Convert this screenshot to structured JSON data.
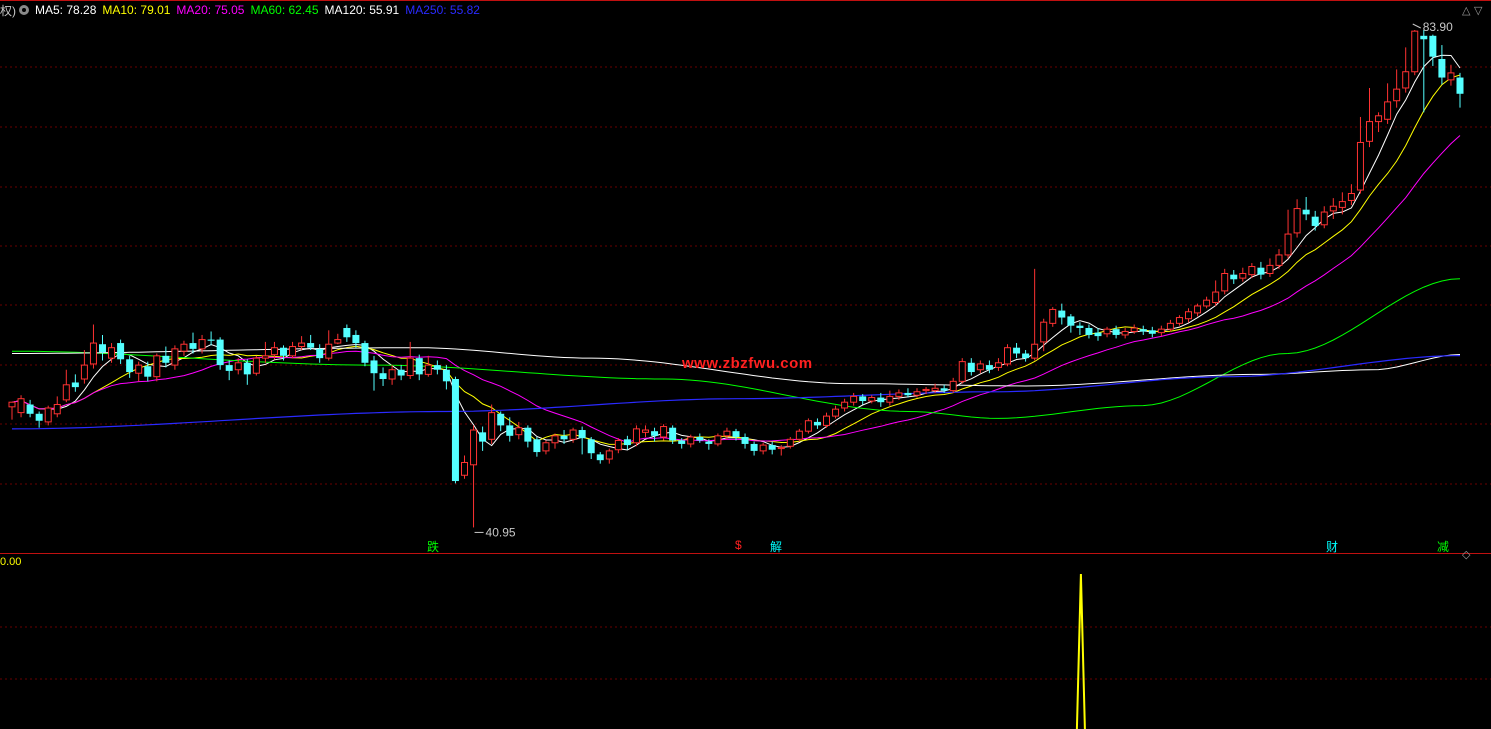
{
  "legend": {
    "prefix": "权)",
    "items": [
      {
        "label": "MA5: 78.28",
        "color": "#ffffff"
      },
      {
        "label": "MA10: 79.01",
        "color": "#ffff00"
      },
      {
        "label": "MA20: 75.05",
        "color": "#ff00ff"
      },
      {
        "label": "MA60: 62.45",
        "color": "#00ff00"
      },
      {
        "label": "MA120: 55.91",
        "color": "#ffffff"
      },
      {
        "label": "MA250: 55.82",
        "color": "#0000ff"
      }
    ]
  },
  "controls": {
    "up": "△",
    "down": "▽",
    "diamond": "◇"
  },
  "annotations": {
    "high": "83.90",
    "low": "40.95"
  },
  "watermark": "www.zbzfwu.com",
  "signals": [
    {
      "text": "跌",
      "color": "#00ff00"
    },
    {
      "text": "$",
      "color": "#ff2020"
    },
    {
      "text": "解",
      "color": "#00ffff"
    },
    {
      "text": "财",
      "color": "#00ffff"
    },
    {
      "text": "减",
      "color": "#00ff00"
    }
  ],
  "sub_panel": {
    "label": "0.00",
    "spike_index": 118
  },
  "chart_data": {
    "type": "candlestick",
    "price_range": [
      40.95,
      83.9
    ],
    "bars": [
      [
        51.4,
        51.8,
        51.6,
        50.3
      ],
      [
        50.9,
        52.1,
        52.4,
        50.5
      ],
      [
        51.6,
        50.8,
        52.0,
        50.5
      ],
      [
        50.8,
        50.2,
        51.0,
        49.6
      ],
      [
        50.1,
        51.3,
        51.5,
        49.8
      ],
      [
        50.8,
        51.6,
        52.3,
        50.5
      ],
      [
        52.0,
        53.3,
        54.6,
        51.8
      ],
      [
        53.5,
        53.1,
        54.2,
        52.7
      ],
      [
        53.8,
        55.0,
        56.3,
        53.4
      ],
      [
        55.1,
        56.9,
        58.5,
        54.7
      ],
      [
        56.8,
        56.1,
        57.6,
        55.4
      ],
      [
        55.6,
        56.5,
        56.9,
        55.2
      ],
      [
        56.9,
        55.5,
        57.2,
        55.1
      ],
      [
        55.5,
        54.4,
        55.8,
        53.9
      ],
      [
        54.3,
        55.0,
        55.3,
        53.6
      ],
      [
        54.9,
        54.0,
        55.3,
        53.6
      ],
      [
        54.0,
        55.8,
        56.0,
        53.6
      ],
      [
        55.8,
        55.2,
        56.6,
        54.8
      ],
      [
        55.0,
        56.4,
        56.7,
        54.6
      ],
      [
        56.2,
        56.8,
        57.1,
        55.8
      ],
      [
        56.9,
        56.4,
        57.8,
        56.0
      ],
      [
        56.4,
        57.2,
        57.6,
        56.0
      ],
      [
        57.2,
        57.1,
        57.9,
        56.7
      ],
      [
        57.2,
        55.0,
        57.4,
        54.6
      ],
      [
        55.0,
        54.5,
        55.4,
        53.7
      ],
      [
        54.6,
        55.2,
        55.6,
        54.2
      ],
      [
        55.2,
        54.2,
        55.5,
        53.3
      ],
      [
        54.3,
        55.6,
        55.8,
        54.1
      ],
      [
        55.6,
        55.8,
        57.0,
        55.2
      ],
      [
        55.9,
        56.5,
        57.0,
        55.5
      ],
      [
        56.5,
        55.8,
        56.7,
        55.4
      ],
      [
        55.8,
        56.6,
        57.0,
        55.6
      ],
      [
        56.6,
        56.9,
        57.5,
        56.3
      ],
      [
        56.9,
        56.5,
        57.6,
        56.3
      ],
      [
        56.4,
        55.6,
        56.8,
        55.2
      ],
      [
        55.6,
        56.8,
        58.0,
        55.4
      ],
      [
        56.9,
        57.2,
        57.7,
        56.8
      ],
      [
        58.2,
        57.4,
        58.5,
        57.0
      ],
      [
        57.6,
        56.9,
        58.0,
        56.5
      ],
      [
        56.9,
        55.2,
        57.1,
        54.9
      ],
      [
        55.4,
        54.3,
        55.8,
        52.8
      ],
      [
        54.3,
        53.8,
        54.8,
        53.2
      ],
      [
        53.8,
        54.6,
        55.0,
        53.3
      ],
      [
        54.6,
        54.1,
        55.0,
        53.7
      ],
      [
        54.1,
        55.6,
        57.0,
        53.8
      ],
      [
        55.6,
        54.2,
        55.9,
        53.7
      ],
      [
        54.2,
        55.0,
        55.8,
        54.0
      ],
      [
        55.0,
        54.6,
        55.4,
        54.2
      ],
      [
        54.6,
        53.6,
        55.0,
        52.9
      ],
      [
        53.8,
        45.0,
        54.0,
        44.8
      ],
      [
        45.5,
        46.6,
        47.2,
        45.2
      ],
      [
        46.4,
        49.4,
        49.8,
        41.0
      ],
      [
        49.2,
        48.4,
        49.7,
        47.6
      ],
      [
        48.6,
        50.9,
        51.6,
        48.2
      ],
      [
        50.8,
        49.8,
        51.0,
        49.3
      ],
      [
        49.8,
        48.9,
        50.5,
        48.4
      ],
      [
        49.0,
        49.6,
        50.1,
        48.6
      ],
      [
        49.6,
        48.4,
        49.8,
        47.9
      ],
      [
        48.6,
        47.5,
        48.8,
        47.1
      ],
      [
        47.6,
        48.3,
        48.5,
        47.3
      ],
      [
        48.3,
        48.9,
        49.1,
        47.8
      ],
      [
        48.9,
        48.6,
        49.4,
        48.2
      ],
      [
        48.6,
        49.4,
        49.6,
        48.3
      ],
      [
        49.4,
        48.7,
        49.7,
        47.3
      ],
      [
        48.6,
        47.4,
        48.8,
        46.9
      ],
      [
        47.3,
        46.8,
        47.5,
        46.5
      ],
      [
        46.9,
        47.6,
        47.8,
        46.5
      ],
      [
        47.7,
        48.5,
        48.7,
        47.4
      ],
      [
        48.6,
        48.1,
        48.9,
        47.7
      ],
      [
        48.3,
        49.5,
        49.8,
        48.0
      ],
      [
        49.2,
        49.4,
        49.8,
        48.8
      ],
      [
        49.3,
        48.9,
        49.6,
        48.4
      ],
      [
        48.8,
        49.7,
        49.9,
        48.5
      ],
      [
        49.6,
        48.5,
        49.8,
        48.2
      ],
      [
        48.5,
        48.2,
        48.7,
        47.8
      ],
      [
        48.2,
        48.8,
        49.0,
        47.9
      ],
      [
        48.8,
        48.5,
        49.1,
        48.3
      ],
      [
        48.4,
        48.2,
        48.6,
        47.7
      ],
      [
        48.2,
        48.9,
        49.1,
        48.0
      ],
      [
        48.9,
        49.3,
        49.6,
        48.6
      ],
      [
        49.3,
        48.8,
        49.5,
        48.5
      ],
      [
        48.8,
        48.2,
        49.1,
        47.8
      ],
      [
        48.2,
        47.6,
        48.4,
        47.2
      ],
      [
        47.6,
        48.1,
        48.3,
        47.3
      ],
      [
        48.1,
        47.7,
        48.4,
        47.3
      ],
      [
        47.8,
        47.9,
        48.1,
        47.2
      ],
      [
        48.0,
        48.6,
        48.8,
        47.8
      ],
      [
        48.6,
        49.3,
        49.5,
        48.4
      ],
      [
        49.3,
        50.2,
        50.4,
        49.1
      ],
      [
        50.1,
        49.8,
        50.4,
        49.5
      ],
      [
        49.8,
        50.6,
        50.9,
        49.6
      ],
      [
        50.6,
        51.2,
        51.5,
        50.4
      ],
      [
        51.3,
        51.8,
        52.1,
        51.0
      ],
      [
        51.8,
        52.3,
        52.6,
        51.5
      ],
      [
        52.3,
        51.9,
        52.5,
        51.6
      ],
      [
        51.9,
        52.2,
        52.4,
        51.7
      ],
      [
        52.2,
        51.8,
        52.6,
        51.4
      ],
      [
        51.8,
        52.3,
        52.8,
        51.5
      ],
      [
        52.3,
        52.6,
        52.9,
        52.0
      ],
      [
        52.6,
        52.4,
        53.0,
        52.2
      ],
      [
        52.4,
        52.7,
        53.0,
        52.2
      ],
      [
        52.8,
        52.9,
        53.1,
        52.5
      ],
      [
        52.8,
        53.0,
        53.4,
        52.6
      ],
      [
        53.0,
        52.8,
        53.3,
        52.6
      ],
      [
        52.8,
        53.6,
        53.9,
        52.6
      ],
      [
        53.6,
        55.3,
        55.6,
        53.4
      ],
      [
        55.2,
        54.4,
        55.6,
        54.1
      ],
      [
        54.6,
        55.1,
        55.4,
        54.3
      ],
      [
        55.0,
        54.6,
        55.4,
        54.3
      ],
      [
        54.8,
        55.2,
        55.6,
        54.5
      ],
      [
        55.1,
        56.5,
        56.8,
        54.9
      ],
      [
        56.5,
        56.0,
        56.9,
        55.6
      ],
      [
        56.0,
        55.6,
        56.3,
        55.3
      ],
      [
        55.6,
        56.8,
        63.3,
        55.4
      ],
      [
        57.0,
        58.7,
        59.0,
        56.2
      ],
      [
        58.6,
        59.8,
        60.0,
        58.3
      ],
      [
        59.7,
        59.1,
        60.3,
        58.5
      ],
      [
        59.2,
        58.4,
        59.4,
        57.8
      ],
      [
        58.4,
        58.2,
        58.7,
        57.6
      ],
      [
        58.2,
        57.6,
        58.5,
        57.3
      ],
      [
        57.8,
        57.5,
        58.2,
        57.1
      ],
      [
        57.7,
        58.1,
        58.3,
        57.4
      ],
      [
        58.1,
        57.6,
        58.4,
        57.3
      ],
      [
        57.6,
        57.9,
        58.2,
        57.3
      ],
      [
        57.9,
        58.2,
        58.5,
        57.7
      ],
      [
        58.1,
        57.9,
        58.4,
        57.6
      ],
      [
        58.0,
        57.7,
        58.3,
        57.4
      ],
      [
        57.8,
        58.1,
        58.4,
        57.5
      ],
      [
        58.1,
        58.6,
        58.9,
        57.9
      ],
      [
        58.6,
        59.1,
        59.3,
        58.4
      ],
      [
        59.0,
        59.6,
        59.9,
        58.7
      ],
      [
        59.5,
        60.1,
        60.3,
        59.2
      ],
      [
        60.1,
        60.6,
        60.9,
        59.9
      ],
      [
        60.4,
        61.3,
        62.3,
        60.1
      ],
      [
        61.4,
        62.9,
        63.3,
        61.1
      ],
      [
        62.8,
        62.4,
        63.2,
        62.0
      ],
      [
        62.5,
        62.9,
        63.4,
        62.2
      ],
      [
        62.8,
        63.5,
        63.8,
        62.5
      ],
      [
        63.4,
        62.8,
        63.9,
        62.4
      ],
      [
        62.9,
        63.6,
        64.2,
        62.6
      ],
      [
        63.6,
        64.5,
        65.0,
        63.3
      ],
      [
        64.5,
        66.3,
        68.4,
        64.2
      ],
      [
        66.4,
        68.5,
        69.3,
        66.0
      ],
      [
        68.4,
        68.0,
        69.5,
        67.5
      ],
      [
        67.8,
        67.0,
        68.3,
        66.6
      ],
      [
        67.1,
        68.2,
        68.7,
        66.8
      ],
      [
        68.3,
        68.7,
        69.4,
        67.6
      ],
      [
        68.6,
        69.1,
        69.9,
        68.0
      ],
      [
        69.2,
        69.8,
        70.6,
        68.8
      ],
      [
        70.1,
        74.2,
        76.4,
        69.8
      ],
      [
        74.3,
        76.0,
        78.9,
        73.8
      ],
      [
        76.0,
        76.5,
        76.8,
        75.1
      ],
      [
        76.2,
        77.7,
        79.3,
        75.8
      ],
      [
        77.8,
        78.8,
        80.5,
        77.2
      ],
      [
        78.9,
        80.3,
        82.4,
        78.5
      ],
      [
        80.3,
        83.8,
        83.9,
        80.0
      ],
      [
        83.4,
        83.1,
        83.9,
        76.8
      ],
      [
        83.4,
        81.6,
        83.5,
        80.8
      ],
      [
        81.4,
        79.8,
        82.6,
        79.2
      ],
      [
        79.6,
        80.2,
        80.9,
        79.1
      ],
      [
        79.8,
        78.4,
        80.2,
        77.2
      ]
    ],
    "ma": [
      {
        "name": "MA5",
        "color": "#ffffff"
      },
      {
        "name": "MA10",
        "color": "#ffff00"
      },
      {
        "name": "MA20",
        "color": "#ff00ff"
      },
      {
        "name": "MA60",
        "color": "#00ff00"
      },
      {
        "name": "MA120",
        "color": "#ffffff"
      },
      {
        "name": "MA250",
        "color": "#0000ff"
      }
    ]
  }
}
